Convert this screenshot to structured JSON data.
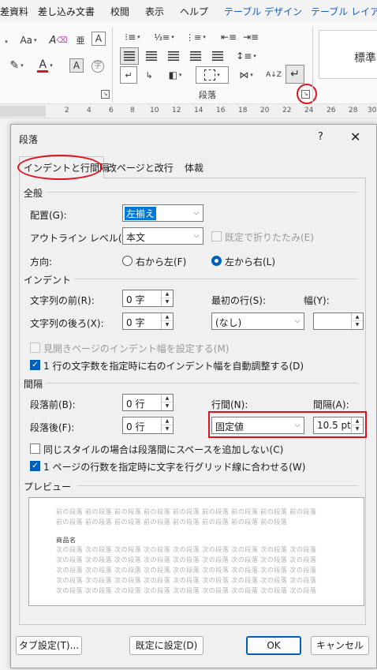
{
  "ribbon": {
    "tabs": [
      "差資料",
      "差し込み文書",
      "校閲",
      "表示",
      "ヘルプ",
      "テーブル デザイン",
      "テーブル レイアウ"
    ],
    "font_size_glyph": "Aa",
    "font_color_glyph": "A",
    "shade_glyph": "A",
    "style_gallery_label": "標準",
    "paragraph_group_label": "段落",
    "sort_glyph": "A↓Z",
    "colors": {
      "design_tab": "#185abd",
      "font_color_bar": "#e81123",
      "annotation": "#e0141e"
    }
  },
  "ruler": {
    "numbers": [
      "2",
      "4",
      "6",
      "8",
      "10",
      "12",
      "14",
      "16",
      "18",
      "20",
      "22",
      "24",
      "26",
      "28",
      "30"
    ]
  },
  "dialog": {
    "title": "段落",
    "help": "?",
    "close": "✕",
    "tabs": {
      "indent": "インデントと行間隔",
      "page_break": "改ページと改行",
      "typography": "体裁"
    },
    "general": {
      "heading": "全般",
      "alignment_label": "配置(G):",
      "alignment_value": "左揃え",
      "outline_label": "アウトライン レベル(O):",
      "outline_value": "本文",
      "collapse_label": "既定で折りたたみ(E)",
      "direction_label": "方向:",
      "rtl_label": "右から左(F)",
      "ltr_label": "左から右(L)"
    },
    "indent": {
      "heading": "インデント",
      "before_label": "文字列の前(R):",
      "before_value": "0 字",
      "after_label": "文字列の後ろ(X):",
      "after_value": "0 字",
      "first_line_label": "最初の行(S):",
      "first_line_value": "(なし)",
      "width_label": "幅(Y):",
      "width_value": "",
      "mirror_label": "見開きページのインデント幅を設定する(M)",
      "auto_adjust_label": "1 行の文字数を指定時に右のインデント幅を自動調整する(D)"
    },
    "spacing": {
      "heading": "間隔",
      "before_label": "段落前(B):",
      "before_value": "0 行",
      "after_label": "段落後(F):",
      "after_value": "0 行",
      "line_spacing_label": "行間(N):",
      "line_spacing_value": "固定値",
      "at_label": "間隔(A):",
      "at_value": "10.5 pt",
      "no_space_label": "同じスタイルの場合は段落間にスペースを追加しない(C)",
      "grid_label": "1 ページの行数を指定時に文字を行グリッド線に合わせる(W)"
    },
    "preview": {
      "heading": "プレビュー",
      "prev_text": "前の段落 前の段落 前の段落 前の段落 前の段落 前の段落 前の段落 前の段落 前の段落",
      "prev_text_2": "前の段落 前の段落 前の段落 前の段落 前の段落 前の段落 前の段落 前の段落",
      "sample_text": "商品名",
      "next_text": "次の段落 次の段落 次の段落 次の段落 次の段落 次の段落 次の段落 次の段落 次の段落"
    },
    "buttons": {
      "tabs": "タブ設定(T)...",
      "default": "既定に設定(D)",
      "ok": "OK",
      "cancel": "キャンセル"
    }
  }
}
